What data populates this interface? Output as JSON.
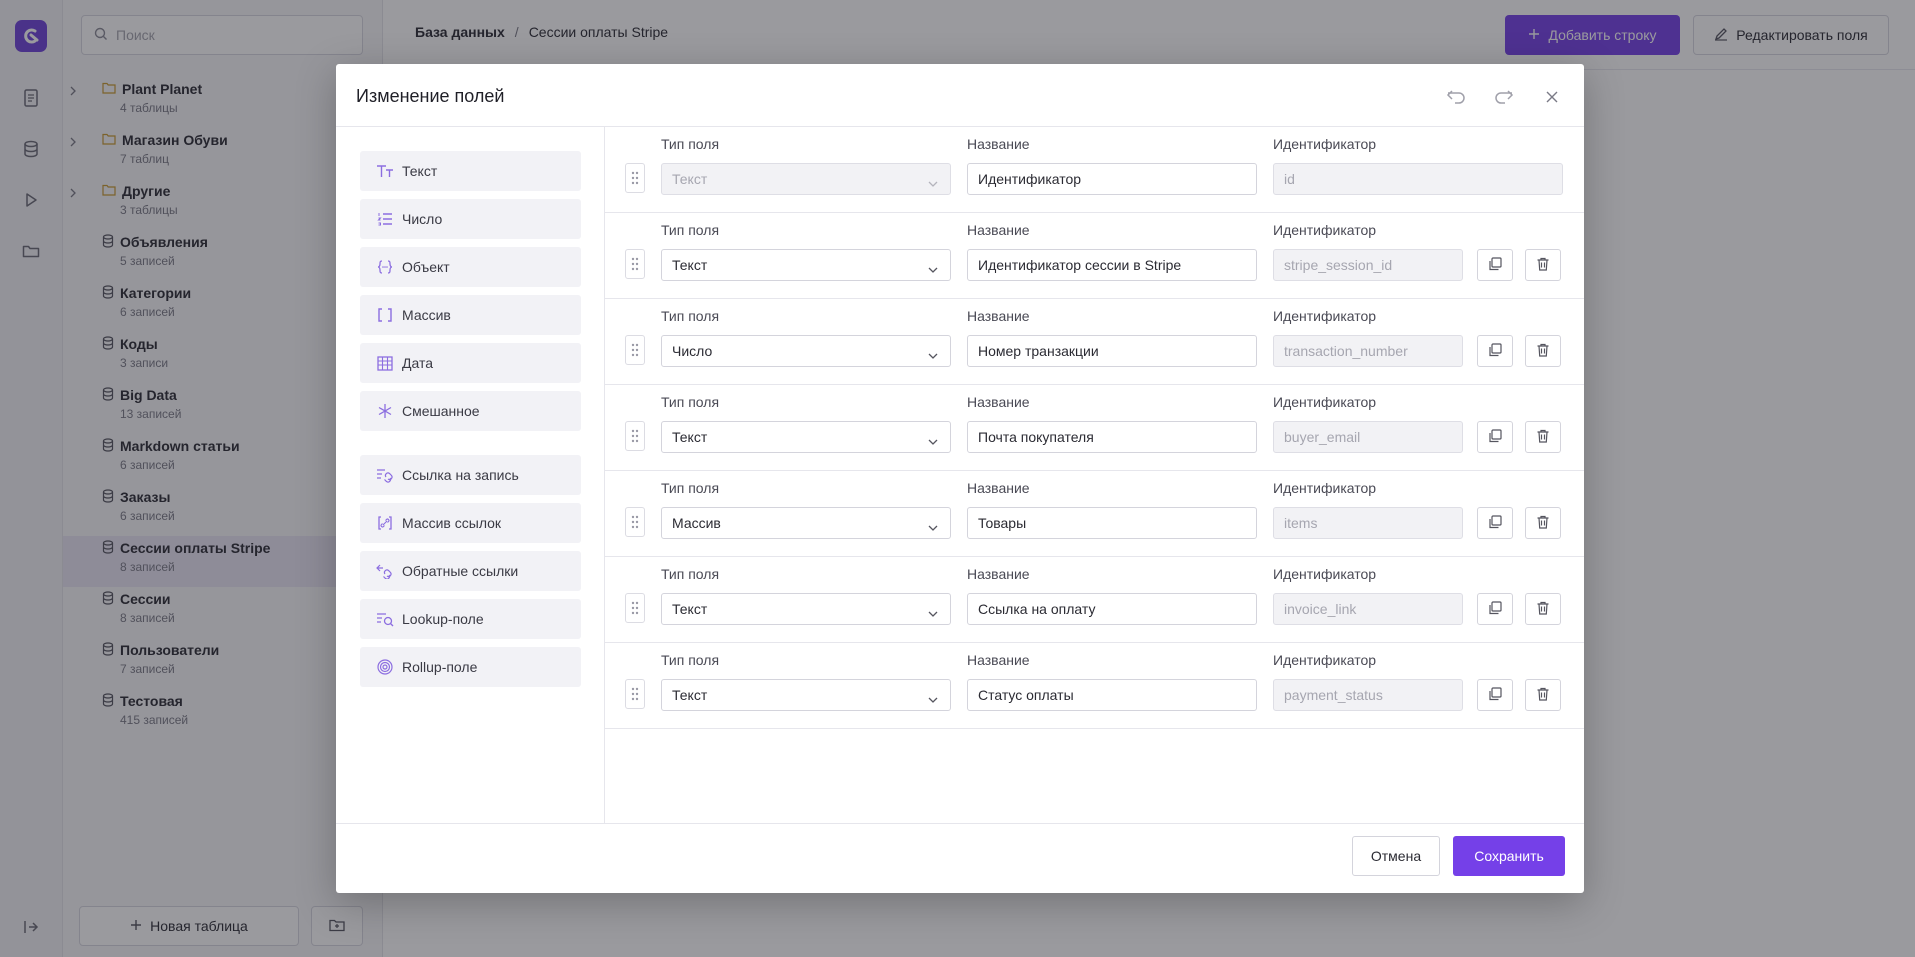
{
  "sidebar": {
    "search_placeholder": "Поиск",
    "items": [
      {
        "title": "Plant Planet",
        "sub": "4 таблицы",
        "kind": "folder"
      },
      {
        "title": "Магазин Обуви",
        "sub": "7 таблиц",
        "kind": "folder"
      },
      {
        "title": "Другие",
        "sub": "3 таблицы",
        "kind": "folder"
      },
      {
        "title": "Объявления",
        "sub": "5 записей",
        "kind": "table"
      },
      {
        "title": "Категории",
        "sub": "6 записей",
        "kind": "table"
      },
      {
        "title": "Коды",
        "sub": "3 записи",
        "kind": "table"
      },
      {
        "title": "Big Data",
        "sub": "13 записей",
        "kind": "table"
      },
      {
        "title": "Markdown статьи",
        "sub": "6 записей",
        "kind": "table"
      },
      {
        "title": "Заказы",
        "sub": "6 записей",
        "kind": "table"
      },
      {
        "title": "Сессии оплаты Stripe",
        "sub": "8 записей",
        "kind": "table",
        "active": true
      },
      {
        "title": "Сессии",
        "sub": "8 записей",
        "kind": "table"
      },
      {
        "title": "Пользователи",
        "sub": "7 записей",
        "kind": "table"
      },
      {
        "title": "Тестовая",
        "sub": "415 записей",
        "kind": "table"
      }
    ],
    "new_table_label": "Новая таблица"
  },
  "topbar": {
    "breadcrumb_root": "База данных",
    "breadcrumb_sep": "/",
    "breadcrumb_current": "Сессии оплаты Stripe",
    "add_row_label": "Добавить строку",
    "edit_fields_label": "Редактировать поля"
  },
  "modal": {
    "title": "Изменение полей",
    "palette": [
      {
        "label": "Текст",
        "icon": "text-type-icon"
      },
      {
        "label": "Число",
        "icon": "number-list-icon"
      },
      {
        "label": "Объект",
        "icon": "object-braces-icon"
      },
      {
        "label": "Массив",
        "icon": "array-brackets-icon"
      },
      {
        "label": "Дата",
        "icon": "calendar-grid-icon"
      },
      {
        "label": "Смешанное",
        "icon": "asterisk-icon"
      },
      {
        "label": "Ссылка на запись",
        "icon": "record-link-icon"
      },
      {
        "label": "Массив ссылок",
        "icon": "link-array-icon"
      },
      {
        "label": "Обратные ссылки",
        "icon": "backlink-icon"
      },
      {
        "label": "Lookup-поле",
        "icon": "lookup-icon"
      },
      {
        "label": "Rollup-поле",
        "icon": "rollup-icon"
      }
    ],
    "labels": {
      "type": "Тип поля",
      "name": "Название",
      "id": "Идентификатор"
    },
    "fields": [
      {
        "type": "Текст",
        "name": "Идентификатор",
        "id": "id",
        "locked": true
      },
      {
        "type": "Текст",
        "name": "Идентификатор сессии в Stripe",
        "id": "stripe_session_id"
      },
      {
        "type": "Число",
        "name": "Номер транзакции",
        "id": "transaction_number"
      },
      {
        "type": "Текст",
        "name": "Почта покупателя",
        "id": "buyer_email"
      },
      {
        "type": "Массив",
        "name": "Товары",
        "id": "items"
      },
      {
        "type": "Текст",
        "name": "Ссылка на оплату",
        "id": "invoice_link"
      },
      {
        "type": "Текст",
        "name": "Статус оплаты",
        "id": "payment_status"
      }
    ],
    "cancel_label": "Отмена",
    "save_label": "Сохранить"
  },
  "colors": {
    "accent": "#7540e8",
    "overlay": "rgba(30,30,40,0.45)"
  }
}
